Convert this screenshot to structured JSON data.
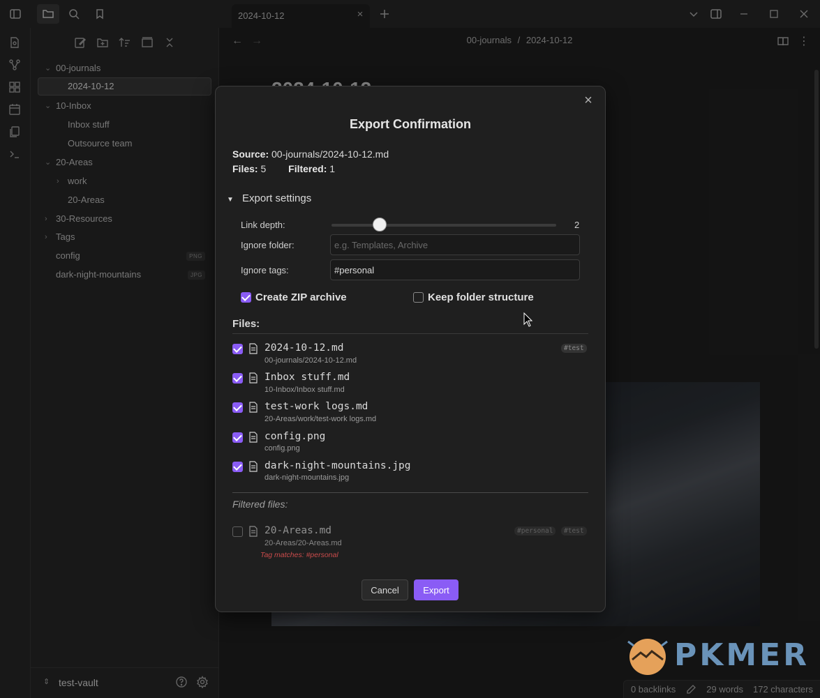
{
  "titlebar": {
    "tab_title": "2024-10-12"
  },
  "sidebar": {
    "tree": [
      {
        "label": "00-journals",
        "kind": "folder-open"
      },
      {
        "label": "2024-10-12",
        "kind": "file-selected"
      },
      {
        "label": "10-Inbox",
        "kind": "folder-open"
      },
      {
        "label": "Inbox stuff",
        "kind": "file"
      },
      {
        "label": "Outsource team",
        "kind": "file"
      },
      {
        "label": "20-Areas",
        "kind": "folder-open"
      },
      {
        "label": "work",
        "kind": "subfolder-closed"
      },
      {
        "label": "20-Areas",
        "kind": "file"
      },
      {
        "label": "30-Resources",
        "kind": "folder-closed"
      },
      {
        "label": "Tags",
        "kind": "folder-closed"
      },
      {
        "label": "config",
        "kind": "file",
        "badge": "PNG"
      },
      {
        "label": "dark-night-mountains",
        "kind": "file",
        "badge": "JPG"
      }
    ],
    "vault_name": "test-vault"
  },
  "main": {
    "breadcrumb_folder": "00-journals",
    "breadcrumb_sep": "/",
    "breadcrumb_file": "2024-10-12",
    "note_title": "2024-10-12"
  },
  "status": {
    "backlinks": "0 backlinks",
    "words": "29 words",
    "characters": "172 characters"
  },
  "modal": {
    "title": "Export Confirmation",
    "source_label": "Source:",
    "source_value": "00-journals/2024-10-12.md",
    "files_label": "Files:",
    "files_value": "5",
    "filtered_label": "Filtered:",
    "filtered_value": "1",
    "settings_heading": "Export settings",
    "link_depth_label": "Link depth:",
    "link_depth_value": "2",
    "link_depth_min": 0,
    "link_depth_max": 10,
    "ignore_folder_label": "Ignore folder:",
    "ignore_folder_placeholder": "e.g. Templates, Archive",
    "ignore_folder_value": "",
    "ignore_tags_label": "Ignore tags:",
    "ignore_tags_value": "#personal",
    "zip_label": "Create ZIP archive",
    "zip_checked": true,
    "keep_structure_label": "Keep folder structure",
    "keep_structure_checked": false,
    "files_heading": "Files:",
    "files": [
      {
        "name": "2024-10-12.md",
        "path": "00-journals/2024-10-12.md",
        "checked": true,
        "tags": [
          "#test"
        ]
      },
      {
        "name": "Inbox stuff.md",
        "path": "10-Inbox/Inbox stuff.md",
        "checked": true,
        "tags": []
      },
      {
        "name": "test-work logs.md",
        "path": "20-Areas/work/test-work logs.md",
        "checked": true,
        "tags": []
      },
      {
        "name": "config.png",
        "path": "config.png",
        "checked": true,
        "tags": []
      },
      {
        "name": "dark-night-mountains.jpg",
        "path": "dark-night-mountains.jpg",
        "checked": true,
        "tags": []
      }
    ],
    "filtered_heading": "Filtered files:",
    "filtered_files": [
      {
        "name": "20-Areas.md",
        "path": "20-Areas/20-Areas.md",
        "checked": false,
        "tags": [
          "#personal",
          "#test"
        ],
        "reason": "Tag matches: #personal"
      }
    ],
    "cancel_label": "Cancel",
    "export_label": "Export"
  },
  "watermark": {
    "text": "PKMER"
  },
  "colors": {
    "accent": "#8a5cf5",
    "background": "#1e1e1e",
    "panel": "#262626",
    "danger": "#c94b4b"
  }
}
